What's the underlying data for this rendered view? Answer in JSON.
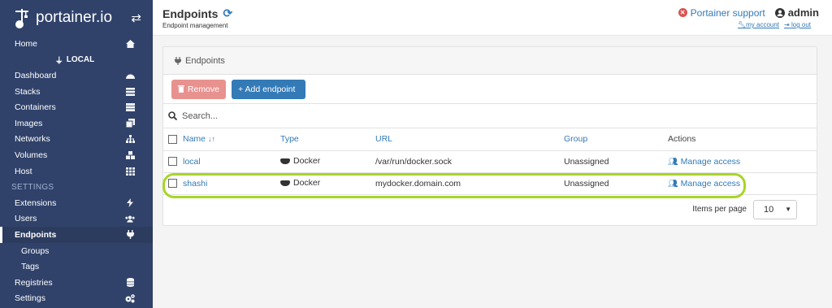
{
  "brand": {
    "name": "portainer.io"
  },
  "sidebar": {
    "home": "Home",
    "endpoint_name": "LOCAL",
    "items": [
      {
        "label": "Dashboard",
        "icon": "tachometer-icon"
      },
      {
        "label": "Stacks",
        "icon": "th-list-icon"
      },
      {
        "label": "Containers",
        "icon": "server-icon"
      },
      {
        "label": "Images",
        "icon": "clone-icon"
      },
      {
        "label": "Networks",
        "icon": "sitemap-icon"
      },
      {
        "label": "Volumes",
        "icon": "cubes-icon"
      },
      {
        "label": "Host",
        "icon": "th-icon"
      }
    ],
    "settings_header": "SETTINGS",
    "settings_items": [
      {
        "label": "Extensions",
        "icon": "bolt-icon"
      },
      {
        "label": "Users",
        "icon": "users-icon"
      },
      {
        "label": "Endpoints",
        "icon": "plug-icon",
        "active": true
      },
      {
        "label": "Groups",
        "sub": true
      },
      {
        "label": "Tags",
        "sub": true
      },
      {
        "label": "Registries",
        "icon": "database-icon"
      },
      {
        "label": "Settings",
        "icon": "cogs-icon"
      }
    ]
  },
  "header": {
    "title": "Endpoints",
    "subtitle": "Endpoint management",
    "support": "Portainer support",
    "user": "admin",
    "my_account": "my account",
    "log_out": "log out"
  },
  "widget": {
    "title": "Endpoints",
    "remove_label": "Remove",
    "add_label": "+ Add endpoint",
    "search_placeholder": "Search...",
    "columns": {
      "name": "Name",
      "type": "Type",
      "url": "URL",
      "group": "Group",
      "actions": "Actions"
    },
    "rows": [
      {
        "name": "local",
        "type": "Docker",
        "url": "/var/run/docker.sock",
        "group": "Unassigned",
        "action": "Manage access"
      },
      {
        "name": "shashi",
        "type": "Docker",
        "url": "mydocker.domain.com",
        "group": "Unassigned",
        "action": "Manage access"
      }
    ],
    "items_per_page_label": "Items per page",
    "items_per_page_value": "10"
  },
  "colors": {
    "sidebar": "#30426a",
    "accent": "#337ab7",
    "danger": "#e8928f",
    "highlight": "#a8d52a"
  }
}
